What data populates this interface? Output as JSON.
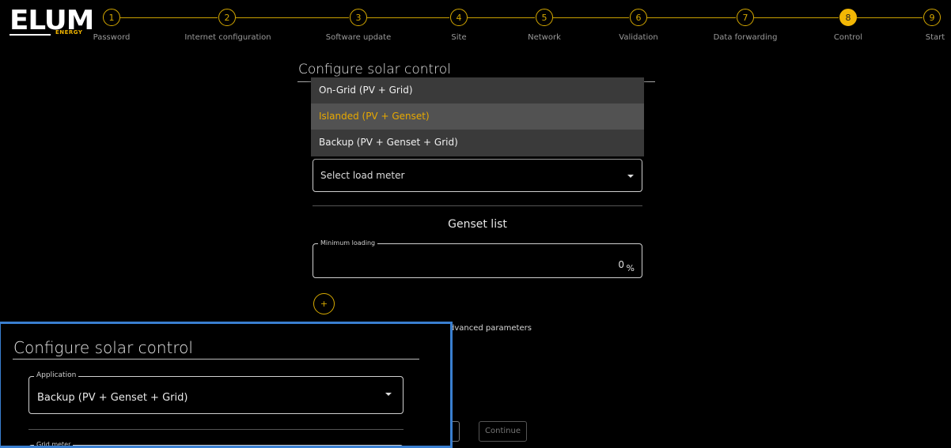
{
  "brand": {
    "logo_text": "ELUM",
    "logo_sub": "ENERGY",
    "accent": "#f2b705"
  },
  "stepper": [
    {
      "num": "1",
      "label": "Password"
    },
    {
      "num": "2",
      "label": "Internet configuration"
    },
    {
      "num": "3",
      "label": "Software update"
    },
    {
      "num": "4",
      "label": "Site"
    },
    {
      "num": "5",
      "label": "Network"
    },
    {
      "num": "6",
      "label": "Validation"
    },
    {
      "num": "7",
      "label": "Data forwarding"
    },
    {
      "num": "8",
      "label": "Control",
      "active": true
    },
    {
      "num": "9",
      "label": "Start"
    }
  ],
  "main": {
    "title": "Configure solar control",
    "dropdown": {
      "options": [
        "On-Grid (PV + Grid)",
        "Islanded (PV + Genset)",
        "Backup (PV + Genset + Grid)"
      ],
      "selected": "Islanded (PV + Genset)"
    },
    "load_meter": {
      "placeholder": "Select load meter"
    },
    "genset_title": "Genset list",
    "min_loading": {
      "label": "Minimum loading",
      "value": "0",
      "unit": "%"
    },
    "add_label": "+",
    "advanced_text": "dvanced parameters",
    "continue_label": "Continue"
  },
  "inset": {
    "title": "Configure solar control",
    "application_label": "Application",
    "application_value": "Backup (PV + Genset + Grid)",
    "grid_meter_label": "Grid meter"
  }
}
